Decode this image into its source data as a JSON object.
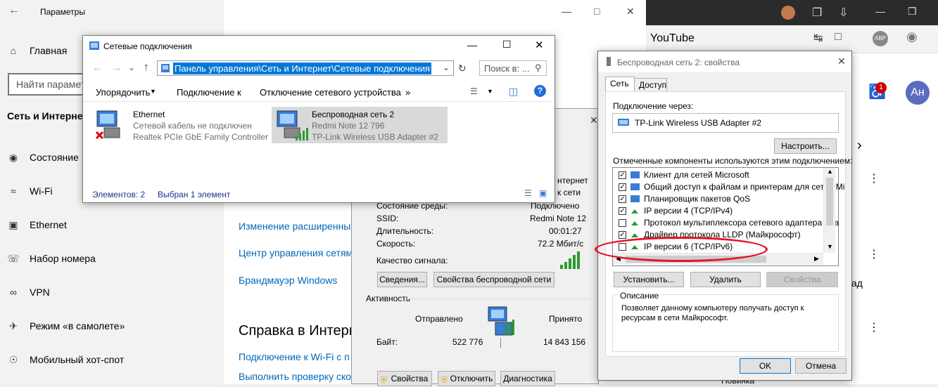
{
  "settings": {
    "title": "Параметры",
    "home": "Главная",
    "search_placeholder": "Найти параметр",
    "section": "Сеть и Интернет",
    "nav": [
      "Состояние",
      "Wi-Fi",
      "Ethernet",
      "Набор номера",
      "VPN",
      "Режим «в самолете»",
      "Мобильный хот-спот"
    ],
    "links": [
      "Изменение расширенных",
      "Центр управления сетями",
      "Брандмауэр Windows"
    ],
    "help_heading": "Справка в Интернет",
    "help_links": [
      "Подключение к Wi-Fi с п",
      "Выполнить проверку ско"
    ]
  },
  "browser": {
    "tab_title": "YouTube",
    "notif_count": "1",
    "avatar": "Ан",
    "frag_1": "ад",
    "frag_2": "Новинка"
  },
  "netwin": {
    "title": "Сетевые подключения",
    "address": "Панель управления\\Сеть и Интернет\\Сетевые подключения",
    "search_placeholder": "Поиск в: ...",
    "commands": [
      "Упорядочить",
      "Подключение к",
      "Отключение сетевого устройства",
      "»"
    ],
    "items": [
      {
        "name": "Ethernet",
        "status": "Сетевой кабель не подключен",
        "adapter": "Realtek PCIe GbE Family Controller"
      },
      {
        "name": "Беспроводная сеть 2",
        "status": "Redmi Note 12 796",
        "adapter": "TP-Link Wireless USB Adapter #2"
      }
    ],
    "status_count": "Элементов: 2",
    "status_selected": "Выбран 1 элемент"
  },
  "statwin": {
    "partial_top": [
      "нтернет",
      "к сети"
    ],
    "rows": [
      {
        "label": "Состояние среды:",
        "value": "Подключено"
      },
      {
        "label": "SSID:",
        "value": "Redmi Note 12"
      },
      {
        "label": "Длительность:",
        "value": "00:01:27"
      },
      {
        "label": "Скорость:",
        "value": "72.2 Мбит/с"
      }
    ],
    "signal_label": "Качество сигнала:",
    "btn_details": "Сведения...",
    "btn_wireless_props": "Свойства беспроводной сети",
    "activity": "Активность",
    "sent": "Отправлено",
    "received": "Принято",
    "bytes_label": "Байт:",
    "bytes_sent": "522 776",
    "bytes_received": "14 843 156",
    "btn_props": "Свойства",
    "btn_disable": "Отключить",
    "btn_diag": "Диагностика"
  },
  "propwin": {
    "title": "Беспроводная сеть 2: свойства",
    "tabs": [
      "Сеть",
      "Доступ"
    ],
    "connect_using": "Подключение через:",
    "adapter": "TP-Link Wireless USB Adapter #2",
    "btn_configure": "Настроить...",
    "components_label": "Отмеченные компоненты используются этим подключением:",
    "components": [
      {
        "checked": true,
        "name": "Клиент для сетей Microsoft"
      },
      {
        "checked": true,
        "name": "Общий доступ к файлам и принтерам для сетей Mi"
      },
      {
        "checked": true,
        "name": "Планировщик пакетов QoS"
      },
      {
        "checked": true,
        "name": "IP версии 4 (TCP/IPv4)"
      },
      {
        "checked": false,
        "name": "Протокол мультиплексора сетевого адаптера (Ма"
      },
      {
        "checked": true,
        "name": "Драйвер протокола LLDP (Майкрософт)"
      },
      {
        "checked": false,
        "name": "IP версии 6 (TCP/IPv6)"
      }
    ],
    "btn_install": "Установить...",
    "btn_remove": "Удалить",
    "btn_properties": "Свойства",
    "description_title": "Описание",
    "description": "Позволяет данному компьютеру получать доступ к ресурсам в сети Майкрософт.",
    "btn_ok": "OK",
    "btn_cancel": "Отмена"
  },
  "colors": {
    "accent": "#0078d7",
    "link": "#0067b8",
    "highlight": "#e81123"
  }
}
